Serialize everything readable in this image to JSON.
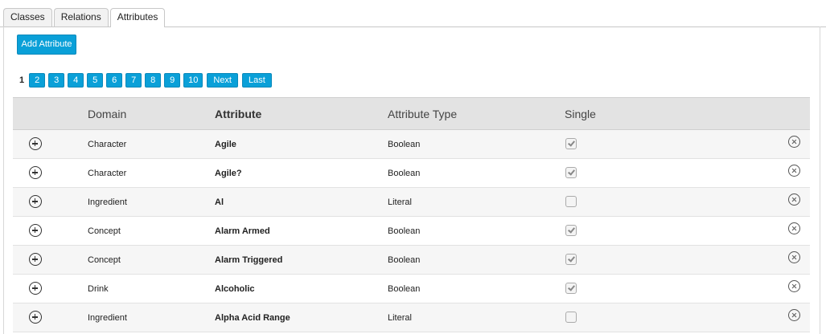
{
  "tabs": {
    "classes": "Classes",
    "relations": "Relations",
    "attributes": "Attributes"
  },
  "add_button_label": "Add Attribute",
  "pagination": {
    "current": "1",
    "pages": [
      "2",
      "3",
      "4",
      "5",
      "6",
      "7",
      "8",
      "9",
      "10"
    ],
    "next": "Next",
    "last": "Last"
  },
  "table": {
    "columns": {
      "domain": "Domain",
      "attribute": "Attribute",
      "type": "Attribute Type",
      "single": "Single"
    },
    "rows": [
      {
        "domain": "Character",
        "attribute": "Agile",
        "type": "Boolean",
        "single": true
      },
      {
        "domain": "Character",
        "attribute": "Agile?",
        "type": "Boolean",
        "single": true
      },
      {
        "domain": "Ingredient",
        "attribute": "Al",
        "type": "Literal",
        "single": false
      },
      {
        "domain": "Concept",
        "attribute": "Alarm Armed",
        "type": "Boolean",
        "single": true
      },
      {
        "domain": "Concept",
        "attribute": "Alarm Triggered",
        "type": "Boolean",
        "single": true
      },
      {
        "domain": "Drink",
        "attribute": "Alcoholic",
        "type": "Boolean",
        "single": true
      },
      {
        "domain": "Ingredient",
        "attribute": "Alpha Acid Range",
        "type": "Literal",
        "single": false
      }
    ]
  },
  "icons": {
    "expand": "plus-circle-icon",
    "delete": "close-circle-icon",
    "single": "checkbox"
  },
  "colors": {
    "accent": "#0aa0d8",
    "header_bg": "#e3e3e3",
    "row_alt": "#f6f6f6"
  }
}
